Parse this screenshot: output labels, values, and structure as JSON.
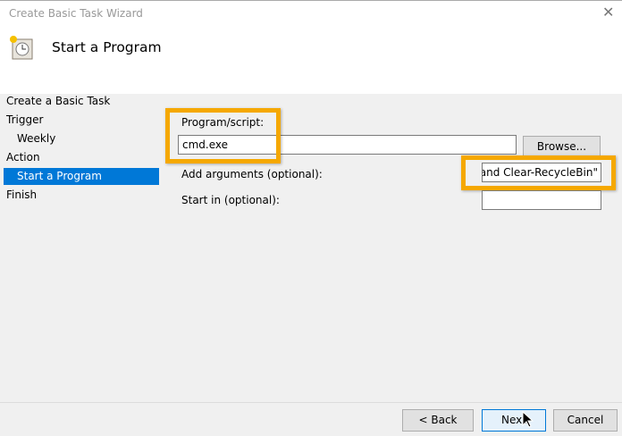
{
  "window": {
    "title": "Create Basic Task Wizard",
    "close_label": "✕",
    "heading": "Start a Program"
  },
  "nav": {
    "items": [
      "Create a Basic Task",
      "Trigger",
      "Weekly",
      "Action",
      "Start a Program",
      "Finish"
    ]
  },
  "form": {
    "program_label": "Program/script:",
    "program_value": "cmd.exe",
    "browse_label": "Browse...",
    "args_label": "Add arguments (optional):",
    "args_value": "mand Clear-RecycleBin\"",
    "startin_label": "Start in (optional):",
    "startin_value": ""
  },
  "buttons": {
    "back": "< Back",
    "next": "Next",
    "cancel": "Cancel"
  },
  "colors": {
    "highlight": "#f5a800",
    "selection": "#0078d7"
  }
}
